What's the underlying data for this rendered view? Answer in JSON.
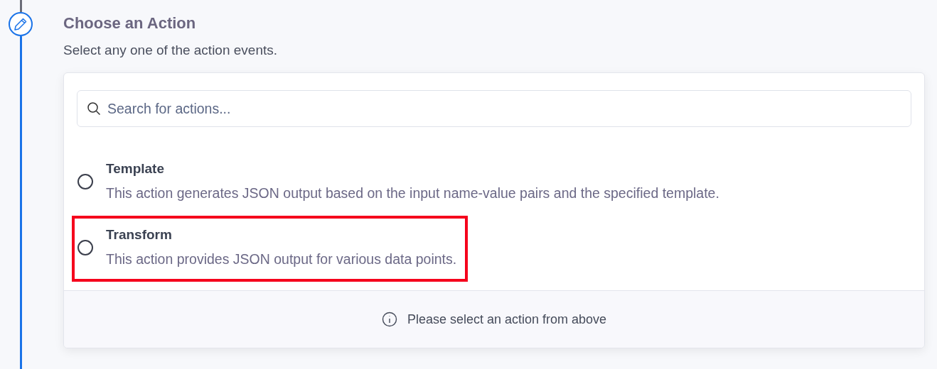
{
  "step": {
    "title": "Choose an Action",
    "subtitle": "Select any one of the action events."
  },
  "search": {
    "placeholder": "Search for actions..."
  },
  "actions": [
    {
      "name": "Template",
      "description": "This action generates JSON output based on the input name-value pairs and the specified template.",
      "selected": false,
      "highlighted": false
    },
    {
      "name": "Transform",
      "description": "This action provides JSON output for various data points.",
      "selected": false,
      "highlighted": true
    }
  ],
  "footer": {
    "message": "Please select an action from above"
  }
}
